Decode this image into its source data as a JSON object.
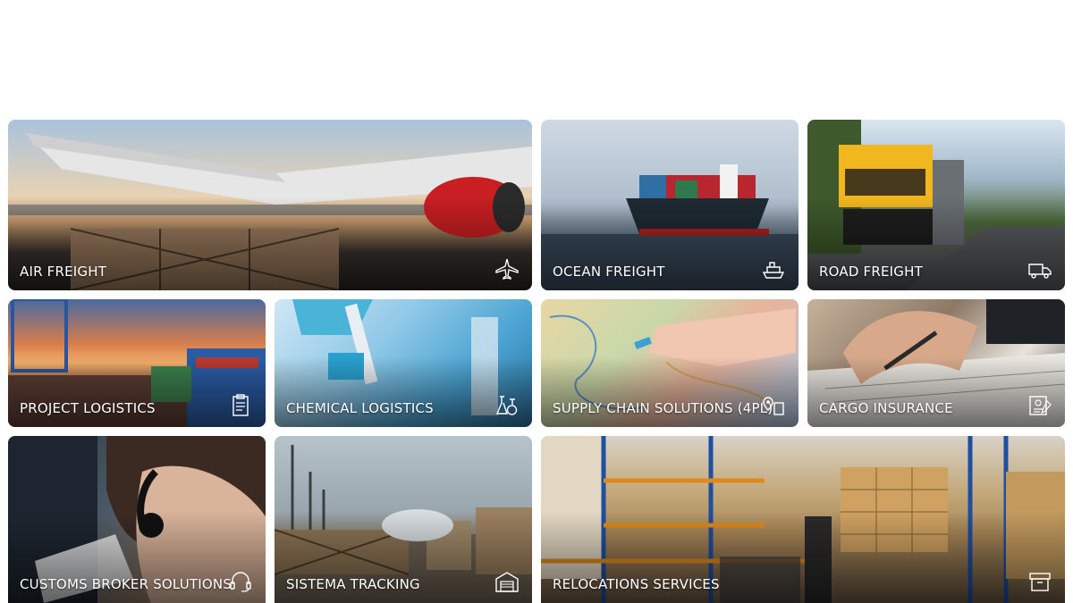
{
  "services": [
    {
      "label": "AIR FREIGHT",
      "icon": "airplane-icon"
    },
    {
      "label": "OCEAN FREIGHT",
      "icon": "ship-icon"
    },
    {
      "label": "ROAD FREIGHT",
      "icon": "truck-icon"
    },
    {
      "label": "PROJECT LOGISTICS",
      "icon": "clipboard-icon"
    },
    {
      "label": "CHEMICAL LOGISTICS",
      "icon": "flask-icon"
    },
    {
      "label": "SUPPLY CHAIN SOLUTIONS (4PL)",
      "icon": "location-pin-icon"
    },
    {
      "label": "CARGO INSURANCE",
      "icon": "certificate-icon"
    },
    {
      "label": "CUSTOMS BROKER SOLUTIONS",
      "icon": "headset-icon"
    },
    {
      "label": "SISTEMA TRACKING",
      "icon": "warehouse-icon"
    },
    {
      "label": "RELOCATIONS SERVICES",
      "icon": "archive-box-icon"
    }
  ]
}
